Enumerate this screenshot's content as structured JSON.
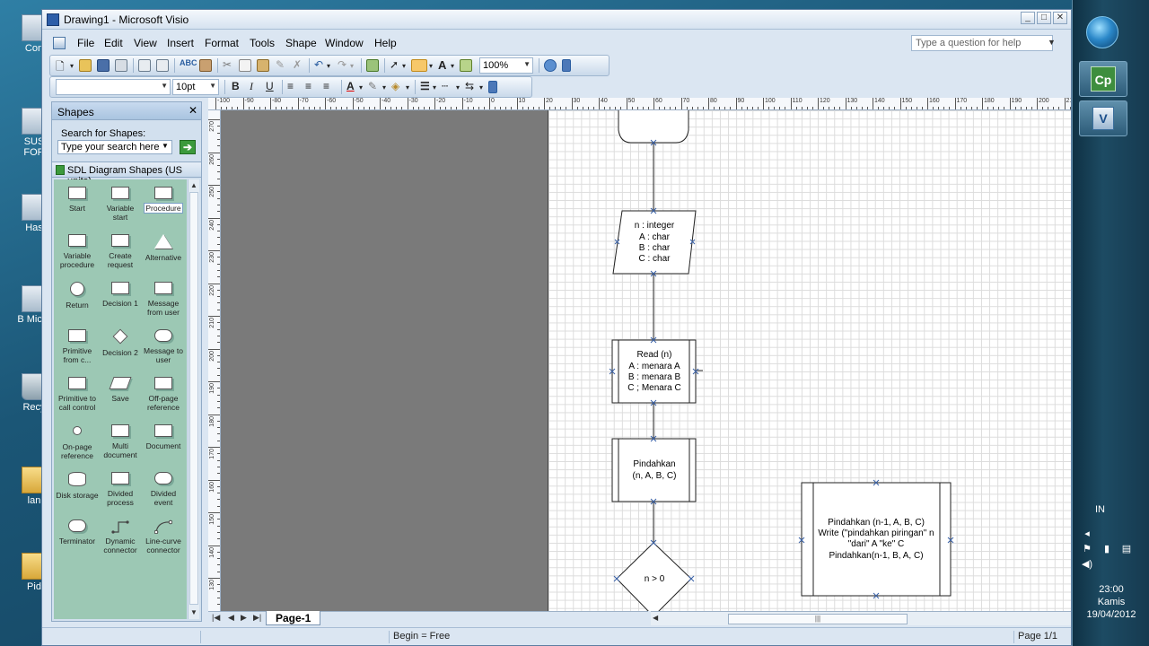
{
  "window": {
    "title": "Drawing1 - Microsoft Visio"
  },
  "menu": {
    "items": [
      "File",
      "Edit",
      "View",
      "Insert",
      "Format",
      "Tools",
      "Shape",
      "Window",
      "Help"
    ],
    "ask_placeholder": "Type a question for help"
  },
  "toolbar": {
    "zoom": "100%",
    "font_size": "10pt",
    "font_name": ""
  },
  "shapes_panel": {
    "title": "Shapes",
    "search_label": "Search for Shapes:",
    "search_placeholder": "Type your search here",
    "stencil_name": "SDL Diagram Shapes (US units)",
    "masters": [
      {
        "label": "Start",
        "icon": "start-shape-icon"
      },
      {
        "label": "Variable start",
        "icon": "variable-start-shape-icon"
      },
      {
        "label": "Procedure",
        "icon": "procedure-shape-icon"
      },
      {
        "label": "Variable procedure",
        "icon": "variable-procedure-shape-icon"
      },
      {
        "label": "Create request",
        "icon": "create-request-shape-icon"
      },
      {
        "label": "Alternative",
        "icon": "alternative-shape-icon"
      },
      {
        "label": "Return",
        "icon": "return-shape-icon"
      },
      {
        "label": "Decision 1",
        "icon": "decision1-shape-icon"
      },
      {
        "label": "Message from user",
        "icon": "message-from-user-shape-icon"
      },
      {
        "label": "Primitive from c...",
        "icon": "primitive-from-shape-icon"
      },
      {
        "label": "Decision 2",
        "icon": "decision2-shape-icon"
      },
      {
        "label": "Message to user",
        "icon": "message-to-user-shape-icon"
      },
      {
        "label": "Primitive to call control",
        "icon": "primitive-to-call-shape-icon"
      },
      {
        "label": "Save",
        "icon": "save-shape-icon"
      },
      {
        "label": "Off-page reference",
        "icon": "off-page-reference-shape-icon"
      },
      {
        "label": "On-page reference",
        "icon": "on-page-reference-shape-icon"
      },
      {
        "label": "Multi document",
        "icon": "multi-document-shape-icon"
      },
      {
        "label": "Document",
        "icon": "document-shape-icon"
      },
      {
        "label": "Disk storage",
        "icon": "disk-storage-shape-icon"
      },
      {
        "label": "Divided process",
        "icon": "divided-process-shape-icon"
      },
      {
        "label": "Divided event",
        "icon": "divided-event-shape-icon"
      },
      {
        "label": "Terminator",
        "icon": "terminator-shape-icon"
      },
      {
        "label": "Dynamic connector",
        "icon": "dynamic-connector-shape-icon"
      },
      {
        "label": "Line-curve connector",
        "icon": "line-curve-connector-shape-icon"
      }
    ]
  },
  "rulers": {
    "horizontal": [
      "-100",
      "-90",
      "-80",
      "-70",
      "-60",
      "-50",
      "-40",
      "-30",
      "-20",
      "-10",
      "0",
      "10",
      "20",
      "30",
      "40",
      "50",
      "60",
      "70",
      "80",
      "90",
      "100",
      "110",
      "120",
      "130",
      "140",
      "150",
      "160",
      "170",
      "180",
      "190",
      "200",
      "210"
    ],
    "vertical": [
      "270",
      "260",
      "250",
      "240",
      "230",
      "220",
      "210",
      "200",
      "190",
      "180",
      "170",
      "160",
      "150",
      "140",
      "130"
    ]
  },
  "diagram": {
    "declare_lines": [
      "n : integer",
      "A : char",
      "B : char",
      "C : char"
    ],
    "read_lines": [
      "Read (n)",
      "A : menara A",
      "B : menara B",
      "C ; Menara C"
    ],
    "call_lines": [
      "Pindahkan",
      "(n, A, B, C)"
    ],
    "decision": "n > 0",
    "proc_lines": [
      "Pindahkan (n-1, A, B, C)",
      "Write (\"pindahkan piringan\" n",
      "\"dari\" A \"ke\" C",
      "Pindahkan(n-1, B, A, C)"
    ]
  },
  "tabs": {
    "page1": "Page-1"
  },
  "status": {
    "begin": "Begin = Free",
    "page": "Page 1/1"
  },
  "desktop": {
    "icons": [
      "Con",
      "SUS FOR",
      "Has",
      "B Micro",
      "Recy",
      "lan",
      "Pid"
    ]
  },
  "taskbar": {
    "lang": "IN",
    "time": "23:00",
    "day": "Kamis",
    "date": "19/04/2012",
    "cp_label": "Cp"
  }
}
